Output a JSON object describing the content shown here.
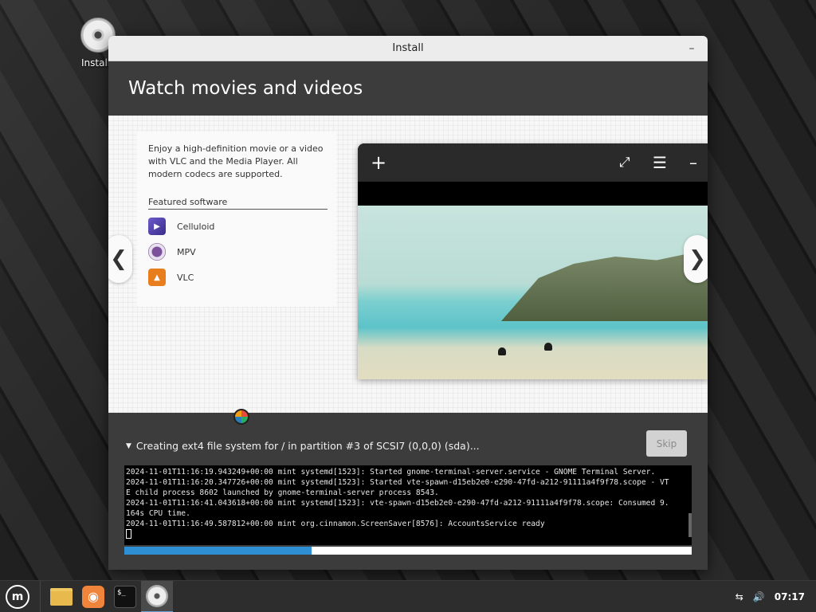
{
  "desktop": {
    "icon_label": "Install"
  },
  "window": {
    "title": "Install",
    "minimize_glyph": "–"
  },
  "slide": {
    "title": "Watch movies and videos",
    "description": "Enjoy a high-definition movie or a video with VLC and the Media Player. All modern codecs are supported.",
    "featured_title": "Featured software",
    "apps": [
      {
        "name": "Celluloid",
        "icon": "celluloid-icon"
      },
      {
        "name": "MPV",
        "icon": "mpv-icon"
      },
      {
        "name": "VLC",
        "icon": "vlc-icon"
      }
    ],
    "prev_glyph": "❮",
    "next_glyph": "❯",
    "player": {
      "add_glyph": "+",
      "expand_glyph": "⤢",
      "menu_glyph": "☰",
      "minimize_glyph": "–"
    }
  },
  "progress": {
    "expander_glyph": "▼",
    "status": "Creating ext4 file system for / in partition #3 of SCSI7 (0,0,0) (sda)...",
    "skip_label": "Skip",
    "percent": 33,
    "log": [
      "2024-11-01T11:16:19.943249+00:00 mint systemd[1523]: Started gnome-terminal-server.service - GNOME Terminal Server.",
      "2024-11-01T11:16:20.347726+00:00 mint systemd[1523]: Started vte-spawn-d15eb2e0-e290-47fd-a212-91111a4f9f78.scope - VT",
      "E child process 8602 launched by gnome-terminal-server process 8543.",
      "2024-11-01T11:16:41.043618+00:00 mint systemd[1523]: vte-spawn-d15eb2e0-e290-47fd-a212-91111a4f9f78.scope: Consumed 9.",
      "164s CPU time.",
      "2024-11-01T11:16:49.587812+00:00 mint org.cinnamon.ScreenSaver[8576]: AccountsService ready"
    ]
  },
  "taskbar": {
    "menu_glyph": "m",
    "firefox_glyph": "◉",
    "terminal_glyph": "$_",
    "network_glyph": "⇆",
    "volume_glyph": "🔊",
    "clock": "07:17"
  }
}
